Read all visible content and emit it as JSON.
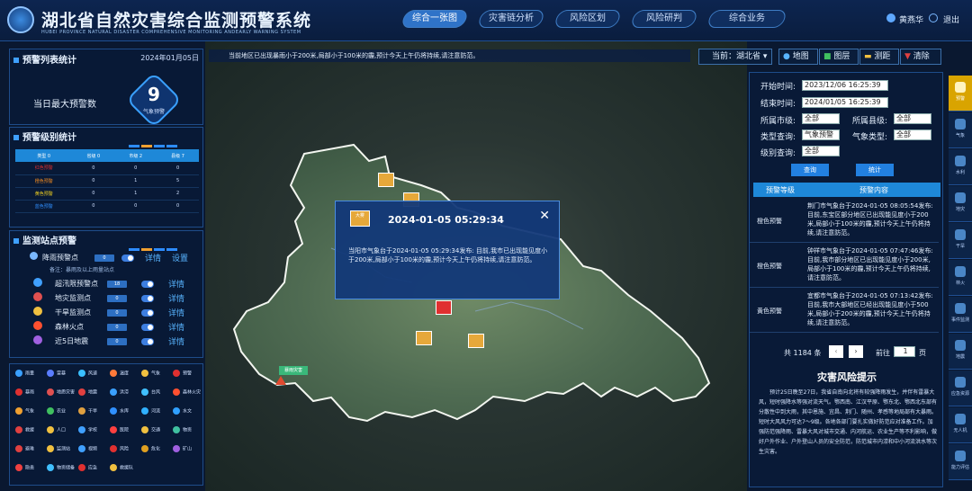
{
  "header": {
    "title": "湖北省自然灾害综合监测预警系统",
    "subtitle": "HUBEI PROVINCE NATURAL DISASTER COMPREHENSIVE MONITORING ANDEARLY WARNING SYSTEM",
    "nav": [
      "综合一张图",
      "灾害链分析",
      "风险区划",
      "风险研判",
      "综合业务"
    ],
    "user": "黄燕华",
    "logout": "退出"
  },
  "ticker": "当前地区已出现暴雨小于200米,局部小于100米的霾,预计今天上午仍将持续,请注意防范。",
  "left": {
    "stats_title": "预警列表统计",
    "date": "2024年01月05日",
    "max_label": "当日最大预警数",
    "max_value": "9",
    "max_unit": "气象预警",
    "level_title": "预警级别统计",
    "level_headers": [
      "类型 0",
      "省级 0",
      "市级 2",
      "县级 7"
    ],
    "level_rows": [
      {
        "name": "红色预警",
        "c": [
          "0",
          "0",
          "0"
        ],
        "color": "#e03030"
      },
      {
        "name": "橙色预警",
        "c": [
          "0",
          "1",
          "5"
        ],
        "color": "#f08a20"
      },
      {
        "name": "黄色预警",
        "c": [
          "0",
          "1",
          "2"
        ],
        "color": "#f0d020"
      },
      {
        "name": "蓝色预警",
        "c": [
          "0",
          "0",
          "0"
        ],
        "color": "#3090ff"
      }
    ],
    "monitor_title": "监测站点预警",
    "rain_label": "降雨预警点",
    "rain_count": "0",
    "detail": "详情",
    "settings": "设置",
    "note": "备注：暴雨及以上雨量站点",
    "stations": [
      {
        "label": "超汛限预警点",
        "count": "18"
      },
      {
        "label": "地灾监测点",
        "count": "0"
      },
      {
        "label": "干旱监测点",
        "count": "0"
      },
      {
        "label": "森林火点",
        "count": "0"
      },
      {
        "label": "近5日地震",
        "count": "0"
      }
    ]
  },
  "legend": [
    [
      "雨量",
      "#3aa0ff"
    ],
    [
      "雷暴",
      "#5a7dff"
    ],
    [
      "风速",
      "#3ac0ff"
    ],
    [
      "温度",
      "#ff7a3a"
    ],
    [
      "气象",
      "#f0c040"
    ],
    [
      "预警",
      "#e03030"
    ],
    [
      "暴雨",
      "#e03030"
    ],
    [
      "地质灾害",
      "#e05050"
    ],
    [
      "地震",
      "#e04040"
    ],
    [
      "洪涝",
      "#3aa0ff"
    ],
    [
      "台风",
      "#40c0ff"
    ],
    [
      "森林火灾",
      "#ff5030"
    ],
    [
      "气象",
      "#f0a030"
    ],
    [
      "农业",
      "#40c060"
    ],
    [
      "干旱",
      "#e0a040"
    ],
    [
      "水库",
      "#3090ff"
    ],
    [
      "河流",
      "#30b0ff"
    ],
    [
      "水文",
      "#30a0ff"
    ],
    [
      "救援",
      "#e04040"
    ],
    [
      "人口",
      "#f0c040"
    ],
    [
      "学校",
      "#40a0ff"
    ],
    [
      "医院",
      "#ff4040"
    ],
    [
      "交通",
      "#f0c040"
    ],
    [
      "物资",
      "#40c0a0"
    ],
    [
      "避难",
      "#e04040"
    ],
    [
      "监测站",
      "#f0c040"
    ],
    [
      "视频",
      "#40a0ff"
    ],
    [
      "风险",
      "#e03030"
    ],
    [
      "危化",
      "#e0a020"
    ],
    [
      "矿山",
      "#a060e0"
    ],
    [
      "隐患",
      "#f04040"
    ],
    [
      "物资储备",
      "#40c0ff"
    ],
    [
      "应急",
      "#e03030"
    ],
    [
      "救援队",
      "#f0c040"
    ]
  ],
  "controls": {
    "region": "当前：湖北省",
    "map": "地图",
    "layer": "图层",
    "measure": "测距",
    "clear": "清除"
  },
  "filter": {
    "start_label": "开始时间:",
    "start": "2023/12/06 16:25:39",
    "end_label": "结束时间:",
    "end": "2024/01/05 16:25:39",
    "city_label": "所属市级:",
    "city": "全部",
    "county_label": "所属县级:",
    "county": "全部",
    "type_label": "类型查询:",
    "type": "气象预警",
    "wtype_label": "气象类型:",
    "wtype": "全部",
    "level_label": "级别查询:",
    "level": "全部",
    "query": "查询",
    "stats": "统计"
  },
  "warn_table": {
    "headers": [
      "预警等级",
      "预警内容"
    ],
    "rows": [
      {
        "level": "橙色预警",
        "text": "荆门市气象台于2024-01-05 08:05:54发布: 目前,东宝区部分地区已出现能见度小于200米,局部小于100米的霾,预计今天上午仍将持续,请注意防范。"
      },
      {
        "level": "橙色预警",
        "text": "钟祥市气象台于2024-01-05 07:47:46发布: 目前,我市部分地区已出现能见度小于200米,局部小于100米的霾,预计今天上午仍将持续,请注意防范。"
      },
      {
        "level": "黄色预警",
        "text": "宜都市气象台于2024-01-05 07:13:42发布: 目前,我市大部地区已经出现能见度小于500米,局部小于200米的霾,预计今天上午仍将持续,请注意防范。"
      }
    ],
    "total": "共 1184 条",
    "goto": "前往",
    "page": "1",
    "page_unit": "页"
  },
  "risk": {
    "title": "灾害风险提示",
    "text": "预计25日晚至27日，我省自南向北将有较强降雨发生，并伴有雷暴大风，短时强降水等强对流天气。鄂西南、江汉平原、鄂东北、鄂西北东部有分散性中到大雨，其中恩施、宜昌、荆门、随州、孝感等地局部有大暴雨。短时大风风力可达7～9级。各地各部门要扎实做好防范应对准备工作。加强防范强降雨、雷暴大风对城市交通、内河航运、农业生产等不利影响，做好户外作业、户外登山人员的安全防范，防范城市内涝和中小河流洪水等次生灾害。"
  },
  "popup": {
    "title": "2024-01-05 05:29:34",
    "text": "当阳市气象台于2024-01-05 05:29:34发布: 目前,我市已出现能见度小于200米,局部小于100米的霾,预计今天上午仍将持续,请注意防范。",
    "badge": "大雾"
  },
  "map": {
    "label_rain": "暴雨灾害"
  },
  "sidebar": [
    "预警",
    "气象",
    "水利",
    "地灾",
    "干旱",
    "林火",
    "事件监测",
    "地震",
    "应急资源",
    "无人机",
    "能力评估"
  ]
}
